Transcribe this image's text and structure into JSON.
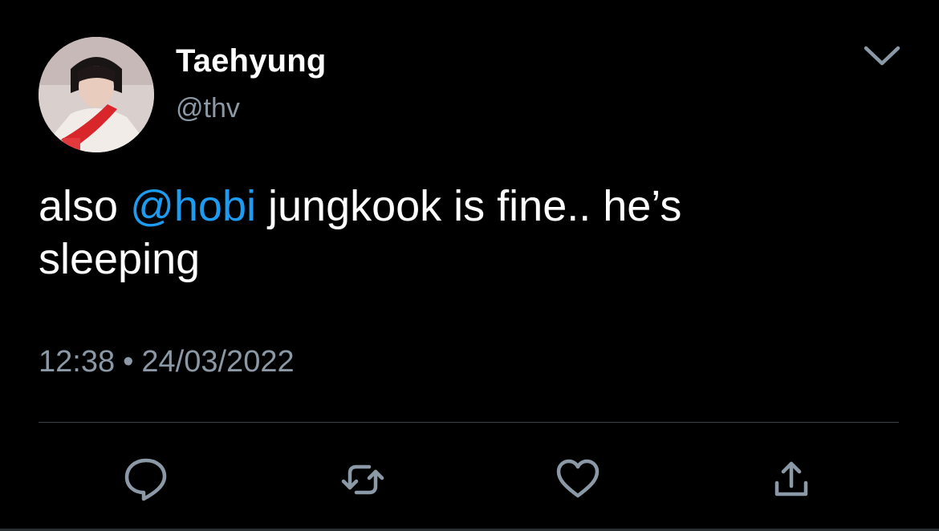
{
  "tweet": {
    "author": {
      "display_name": "Taehyung",
      "handle": "@thv"
    },
    "text": {
      "prefix": "also ",
      "mention": "@hobi",
      "line1_rest": " jungkook is fine.. he’s",
      "line2": "sleeping"
    },
    "time": "12:38",
    "separator": "•",
    "date": "24/03/2022",
    "actions": [
      "reply-icon",
      "retweet-icon",
      "like-icon",
      "share-icon"
    ],
    "menu_icon": "chevron-down-icon"
  },
  "colors": {
    "background": "#000000",
    "text": "#ffffff",
    "secondary_text": "#8b98a5",
    "mention": "#1d9bf0",
    "icon": "#8b98a5",
    "divider": "#38444d"
  }
}
